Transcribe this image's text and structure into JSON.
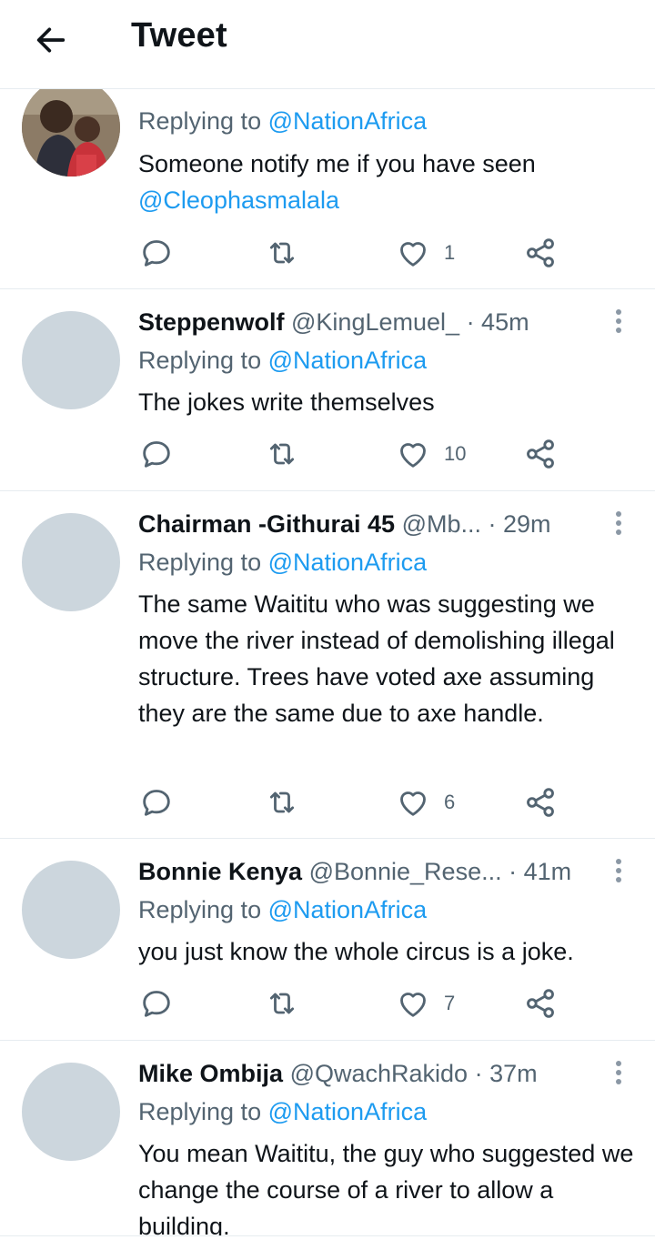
{
  "header": {
    "title": "Tweet"
  },
  "tweets": [
    {
      "name": "",
      "handle": "",
      "time": "",
      "replying_label": "Replying to",
      "replying_to": "@NationAfrica",
      "text_before": "Someone notify me if you have seen ",
      "text_mention": "@Cleophasmalala",
      "replies": "",
      "retweets": "",
      "likes": "1"
    },
    {
      "name": "Steppenwolf",
      "handle": "@KingLemuel_",
      "time": "· 45m",
      "replying_label": "Replying to",
      "replying_to": "@NationAfrica",
      "text": "The jokes write themselves",
      "likes": "10"
    },
    {
      "name": "Chairman -Githurai 45",
      "handle": "@Mb...",
      "time": "· 29m",
      "replying_label": "Replying to",
      "replying_to": "@NationAfrica",
      "text": "The same Waititu who was suggesting we move the river instead of demolishing illegal structure. Trees have voted axe assuming they are the same due to axe handle.",
      "likes": "6"
    },
    {
      "name": "Bonnie Kenya",
      "handle": "@Bonnie_Rese...",
      "time": "· 41m",
      "replying_label": "Replying to",
      "replying_to": "@NationAfrica",
      "text": "you just know the whole circus is a joke.",
      "likes": "7"
    },
    {
      "name": "Mike Ombija",
      "handle": "@QwachRakido",
      "time": "· 37m",
      "replying_label": "Replying to",
      "replying_to": "@NationAfrica",
      "text": "You mean Waititu, the guy who suggested we change the course of a river to allow a building."
    }
  ],
  "icons": {
    "back": "arrow-left-icon",
    "reply": "reply-icon",
    "retweet": "retweet-icon",
    "like": "heart-icon",
    "share": "share-icon",
    "more": "more-vertical-icon"
  },
  "colors": {
    "link": "#1d9bf0",
    "secondary_text": "#536471",
    "avatar_placeholder": "#ccd6dd",
    "divider": "#e6ecf0"
  }
}
